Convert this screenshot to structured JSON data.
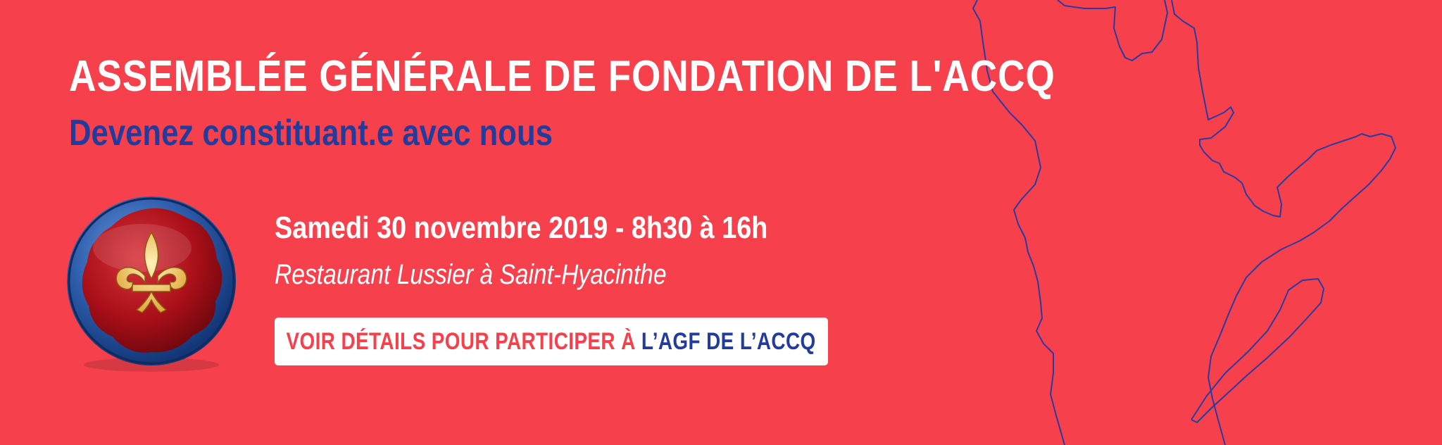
{
  "banner": {
    "title": "ASSEMBLÉE GÉNÉRALE DE FONDATION DE L'ACCQ",
    "subtitle": "Devenez constituant.e avec nous",
    "event_date": "Samedi 30 novembre 2019 - 8h30 à 16h",
    "venue": "Restaurant Lussier à Saint-Hyacinthe",
    "cta": {
      "part1": "VOIR DÉTAILS POUR PARTICIPER À",
      "part2": "L’AGF DE L’ACCQ"
    },
    "emblem_icon": "fleur-de-lis-seal-icon",
    "map_icon": "quebec-map-outline-icon"
  },
  "colors": {
    "background": "#f6414d",
    "accent_blue": "#233c9b",
    "white": "#ffffff",
    "seal_red": "#b3141c",
    "seal_blue": "#2f5fae",
    "fleur_gold": "#f2c766"
  }
}
